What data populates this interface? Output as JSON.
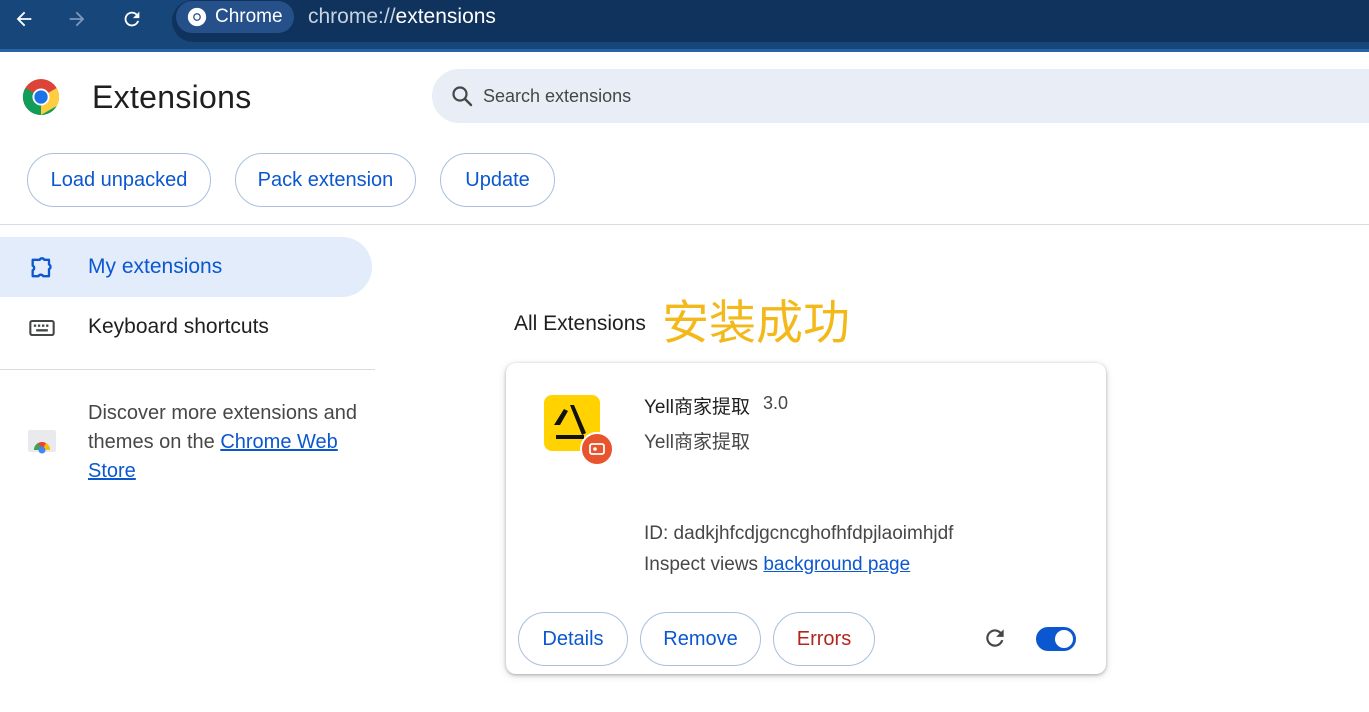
{
  "browser": {
    "back_icon": "arrow-left-icon",
    "forward_icon": "arrow-right-icon",
    "reload_icon": "reload-icon",
    "chip_label": "Chrome",
    "url_scheme": "chrome://",
    "url_host": "extensions",
    "colors": {
      "toolbar": "#17467a",
      "omnibox": "#0f335d"
    }
  },
  "header": {
    "title": "Extensions",
    "search_placeholder": "Search extensions"
  },
  "toolbar": {
    "load_unpacked": "Load unpacked",
    "pack_extension": "Pack extension",
    "update": "Update"
  },
  "sidebar": {
    "items": [
      {
        "label": "My extensions",
        "icon": "puzzle-icon",
        "active": true
      },
      {
        "label": "Keyboard shortcuts",
        "icon": "keyboard-icon",
        "active": false
      }
    ],
    "store_text_before": "Discover more extensions and themes on the ",
    "store_link": "Chrome Web Store"
  },
  "main": {
    "section_title": "All Extensions",
    "annotation": "安装成功",
    "annotation_color": "#f3b819",
    "extension": {
      "name": "Yell商家提取",
      "version": "3.0",
      "description": "Yell商家提取",
      "id_line": "ID: dadkjhfcdjgcncghofhfdpjlaoimhjdf",
      "inspect_prefix": "Inspect views ",
      "inspect_link": "background page",
      "enabled": true,
      "buttons": {
        "details": "Details",
        "remove": "Remove",
        "errors": "Errors"
      }
    }
  },
  "colors": {
    "accent": "#0b57d0",
    "error": "#b3261e"
  }
}
